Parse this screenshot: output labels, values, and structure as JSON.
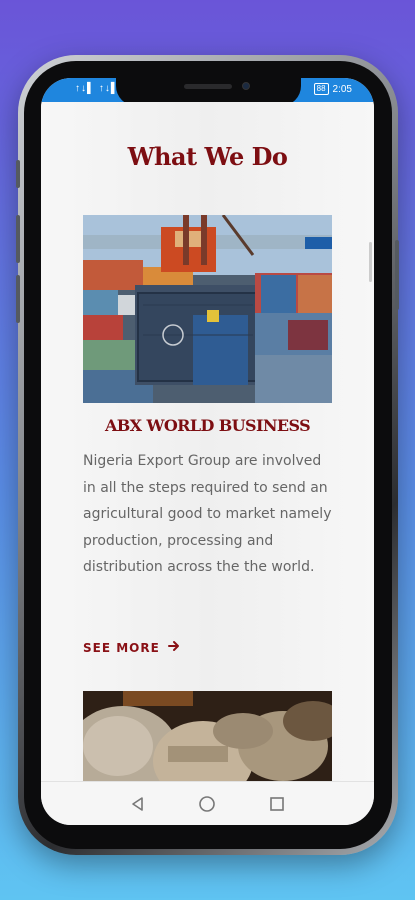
{
  "status_bar": {
    "signal": "↑↓▌ ↑↓▌ ◠",
    "battery": "88",
    "time": "2:05"
  },
  "section": {
    "title": "What We Do"
  },
  "card": {
    "title": "ABX WORLD BUSINESS",
    "description": "Nigeria Export Group are involved in all the steps required to send an agricultural good to market namely production, processing and distribution across the the world.",
    "see_more_label": "SEE MORE",
    "see_more_icon": "arrow-right-icon"
  },
  "colors": {
    "accent": "#7d0e12",
    "status_bar": "#1f86de",
    "background_top": "#6a55d8",
    "background_bottom": "#5fc4f2"
  },
  "nav": {
    "icons": [
      "back-icon",
      "home-icon",
      "recents-icon"
    ]
  }
}
